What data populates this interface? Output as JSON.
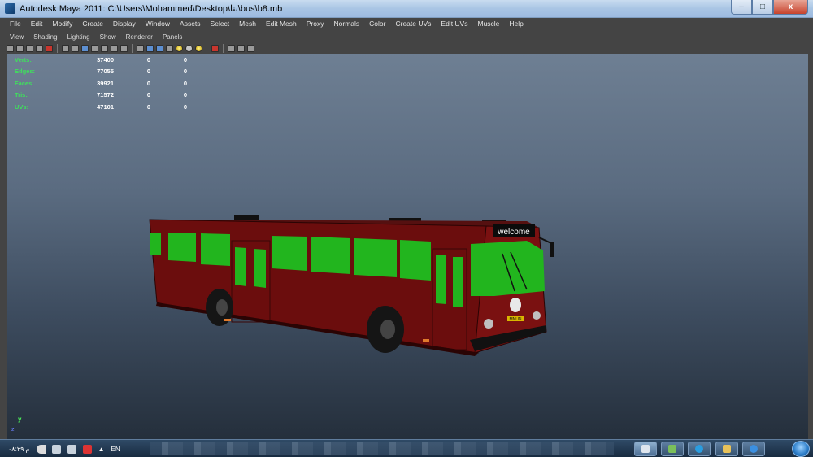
{
  "window": {
    "title": "Autodesk Maya 2011: C:\\Users\\Mohammed\\Desktop\\بنا\\bus\\b8.mb",
    "minimize": "–",
    "maximize": "□",
    "close": "x"
  },
  "menubar": {
    "items": [
      "File",
      "Edit",
      "Modify",
      "Create",
      "Display",
      "Window",
      "Assets",
      "Select",
      "Mesh",
      "Edit Mesh",
      "Proxy",
      "Normals",
      "Color",
      "Create UVs",
      "Edit UVs",
      "Muscle",
      "Help"
    ]
  },
  "panel_menu": {
    "items": [
      "View",
      "Shading",
      "Lighting",
      "Show",
      "Renderer",
      "Panels"
    ]
  },
  "hud": {
    "rows": [
      {
        "label": "Verts:",
        "v1": "37400",
        "v2": "0",
        "v3": "0"
      },
      {
        "label": "Edges:",
        "v1": "77055",
        "v2": "0",
        "v3": "0"
      },
      {
        "label": "Faces:",
        "v1": "39921",
        "v2": "0",
        "v3": "0"
      },
      {
        "label": "Tris:",
        "v1": "71572",
        "v2": "0",
        "v3": "0"
      },
      {
        "label": "UVs:",
        "v1": "47101",
        "v2": "0",
        "v3": "0"
      }
    ]
  },
  "scene": {
    "destination_sign": "welcome",
    "plate": "MNUN",
    "camera": "persp",
    "axis_y": "y",
    "axis_z": "z",
    "body_color": "#6b0d0d",
    "window_color": "#22b51e"
  },
  "taskbar": {
    "clock": "م ٠٨:٢٩",
    "lang": "EN",
    "tray_arrow": "▲"
  }
}
